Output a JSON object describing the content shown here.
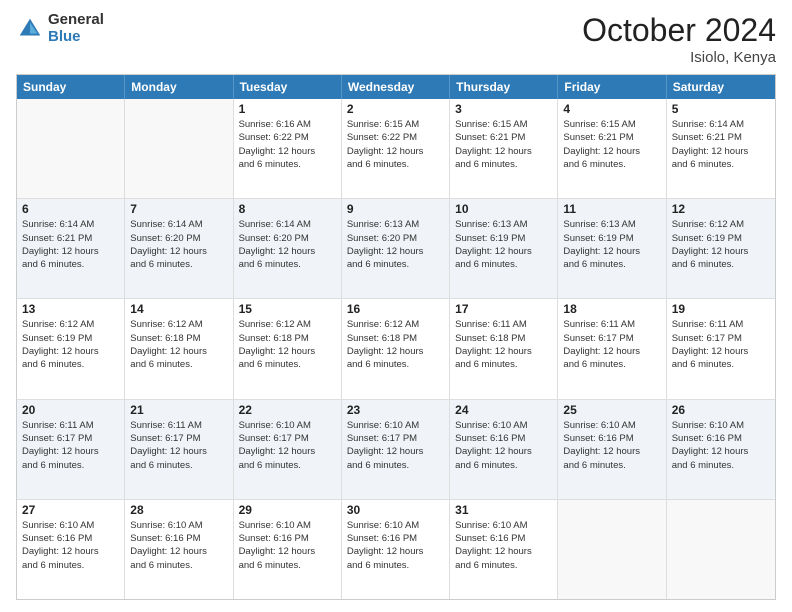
{
  "logo": {
    "general": "General",
    "blue": "Blue"
  },
  "header": {
    "month": "October 2024",
    "location": "Isiolo, Kenya"
  },
  "weekdays": [
    "Sunday",
    "Monday",
    "Tuesday",
    "Wednesday",
    "Thursday",
    "Friday",
    "Saturday"
  ],
  "rows": [
    {
      "alt": false,
      "cells": [
        {
          "day": "",
          "empty": true,
          "lines": []
        },
        {
          "day": "",
          "empty": true,
          "lines": []
        },
        {
          "day": "1",
          "empty": false,
          "lines": [
            "Sunrise: 6:16 AM",
            "Sunset: 6:22 PM",
            "Daylight: 12 hours",
            "and 6 minutes."
          ]
        },
        {
          "day": "2",
          "empty": false,
          "lines": [
            "Sunrise: 6:15 AM",
            "Sunset: 6:22 PM",
            "Daylight: 12 hours",
            "and 6 minutes."
          ]
        },
        {
          "day": "3",
          "empty": false,
          "lines": [
            "Sunrise: 6:15 AM",
            "Sunset: 6:21 PM",
            "Daylight: 12 hours",
            "and 6 minutes."
          ]
        },
        {
          "day": "4",
          "empty": false,
          "lines": [
            "Sunrise: 6:15 AM",
            "Sunset: 6:21 PM",
            "Daylight: 12 hours",
            "and 6 minutes."
          ]
        },
        {
          "day": "5",
          "empty": false,
          "lines": [
            "Sunrise: 6:14 AM",
            "Sunset: 6:21 PM",
            "Daylight: 12 hours",
            "and 6 minutes."
          ]
        }
      ]
    },
    {
      "alt": true,
      "cells": [
        {
          "day": "6",
          "empty": false,
          "lines": [
            "Sunrise: 6:14 AM",
            "Sunset: 6:21 PM",
            "Daylight: 12 hours",
            "and 6 minutes."
          ]
        },
        {
          "day": "7",
          "empty": false,
          "lines": [
            "Sunrise: 6:14 AM",
            "Sunset: 6:20 PM",
            "Daylight: 12 hours",
            "and 6 minutes."
          ]
        },
        {
          "day": "8",
          "empty": false,
          "lines": [
            "Sunrise: 6:14 AM",
            "Sunset: 6:20 PM",
            "Daylight: 12 hours",
            "and 6 minutes."
          ]
        },
        {
          "day": "9",
          "empty": false,
          "lines": [
            "Sunrise: 6:13 AM",
            "Sunset: 6:20 PM",
            "Daylight: 12 hours",
            "and 6 minutes."
          ]
        },
        {
          "day": "10",
          "empty": false,
          "lines": [
            "Sunrise: 6:13 AM",
            "Sunset: 6:19 PM",
            "Daylight: 12 hours",
            "and 6 minutes."
          ]
        },
        {
          "day": "11",
          "empty": false,
          "lines": [
            "Sunrise: 6:13 AM",
            "Sunset: 6:19 PM",
            "Daylight: 12 hours",
            "and 6 minutes."
          ]
        },
        {
          "day": "12",
          "empty": false,
          "lines": [
            "Sunrise: 6:12 AM",
            "Sunset: 6:19 PM",
            "Daylight: 12 hours",
            "and 6 minutes."
          ]
        }
      ]
    },
    {
      "alt": false,
      "cells": [
        {
          "day": "13",
          "empty": false,
          "lines": [
            "Sunrise: 6:12 AM",
            "Sunset: 6:19 PM",
            "Daylight: 12 hours",
            "and 6 minutes."
          ]
        },
        {
          "day": "14",
          "empty": false,
          "lines": [
            "Sunrise: 6:12 AM",
            "Sunset: 6:18 PM",
            "Daylight: 12 hours",
            "and 6 minutes."
          ]
        },
        {
          "day": "15",
          "empty": false,
          "lines": [
            "Sunrise: 6:12 AM",
            "Sunset: 6:18 PM",
            "Daylight: 12 hours",
            "and 6 minutes."
          ]
        },
        {
          "day": "16",
          "empty": false,
          "lines": [
            "Sunrise: 6:12 AM",
            "Sunset: 6:18 PM",
            "Daylight: 12 hours",
            "and 6 minutes."
          ]
        },
        {
          "day": "17",
          "empty": false,
          "lines": [
            "Sunrise: 6:11 AM",
            "Sunset: 6:18 PM",
            "Daylight: 12 hours",
            "and 6 minutes."
          ]
        },
        {
          "day": "18",
          "empty": false,
          "lines": [
            "Sunrise: 6:11 AM",
            "Sunset: 6:17 PM",
            "Daylight: 12 hours",
            "and 6 minutes."
          ]
        },
        {
          "day": "19",
          "empty": false,
          "lines": [
            "Sunrise: 6:11 AM",
            "Sunset: 6:17 PM",
            "Daylight: 12 hours",
            "and 6 minutes."
          ]
        }
      ]
    },
    {
      "alt": true,
      "cells": [
        {
          "day": "20",
          "empty": false,
          "lines": [
            "Sunrise: 6:11 AM",
            "Sunset: 6:17 PM",
            "Daylight: 12 hours",
            "and 6 minutes."
          ]
        },
        {
          "day": "21",
          "empty": false,
          "lines": [
            "Sunrise: 6:11 AM",
            "Sunset: 6:17 PM",
            "Daylight: 12 hours",
            "and 6 minutes."
          ]
        },
        {
          "day": "22",
          "empty": false,
          "lines": [
            "Sunrise: 6:10 AM",
            "Sunset: 6:17 PM",
            "Daylight: 12 hours",
            "and 6 minutes."
          ]
        },
        {
          "day": "23",
          "empty": false,
          "lines": [
            "Sunrise: 6:10 AM",
            "Sunset: 6:17 PM",
            "Daylight: 12 hours",
            "and 6 minutes."
          ]
        },
        {
          "day": "24",
          "empty": false,
          "lines": [
            "Sunrise: 6:10 AM",
            "Sunset: 6:16 PM",
            "Daylight: 12 hours",
            "and 6 minutes."
          ]
        },
        {
          "day": "25",
          "empty": false,
          "lines": [
            "Sunrise: 6:10 AM",
            "Sunset: 6:16 PM",
            "Daylight: 12 hours",
            "and 6 minutes."
          ]
        },
        {
          "day": "26",
          "empty": false,
          "lines": [
            "Sunrise: 6:10 AM",
            "Sunset: 6:16 PM",
            "Daylight: 12 hours",
            "and 6 minutes."
          ]
        }
      ]
    },
    {
      "alt": false,
      "cells": [
        {
          "day": "27",
          "empty": false,
          "lines": [
            "Sunrise: 6:10 AM",
            "Sunset: 6:16 PM",
            "Daylight: 12 hours",
            "and 6 minutes."
          ]
        },
        {
          "day": "28",
          "empty": false,
          "lines": [
            "Sunrise: 6:10 AM",
            "Sunset: 6:16 PM",
            "Daylight: 12 hours",
            "and 6 minutes."
          ]
        },
        {
          "day": "29",
          "empty": false,
          "lines": [
            "Sunrise: 6:10 AM",
            "Sunset: 6:16 PM",
            "Daylight: 12 hours",
            "and 6 minutes."
          ]
        },
        {
          "day": "30",
          "empty": false,
          "lines": [
            "Sunrise: 6:10 AM",
            "Sunset: 6:16 PM",
            "Daylight: 12 hours",
            "and 6 minutes."
          ]
        },
        {
          "day": "31",
          "empty": false,
          "lines": [
            "Sunrise: 6:10 AM",
            "Sunset: 6:16 PM",
            "Daylight: 12 hours",
            "and 6 minutes."
          ]
        },
        {
          "day": "",
          "empty": true,
          "lines": []
        },
        {
          "day": "",
          "empty": true,
          "lines": []
        }
      ]
    }
  ]
}
